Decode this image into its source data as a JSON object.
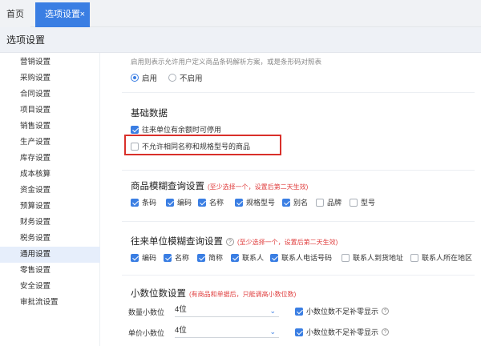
{
  "tabs": {
    "home": "首页",
    "active": "选项设置",
    "close": "×"
  },
  "page_title": "选项设置",
  "sidebar": {
    "items": [
      {
        "label": "营销设置"
      },
      {
        "label": "采购设置"
      },
      {
        "label": "合同设置"
      },
      {
        "label": "项目设置"
      },
      {
        "label": "销售设置"
      },
      {
        "label": "生产设置"
      },
      {
        "label": "库存设置"
      },
      {
        "label": "成本核算"
      },
      {
        "label": "资金设置"
      },
      {
        "label": "预算设置"
      },
      {
        "label": "财务设置"
      },
      {
        "label": "税务设置"
      },
      {
        "label": "通用设置"
      },
      {
        "label": "零售设置"
      },
      {
        "label": "安全设置"
      },
      {
        "label": "审批流设置"
      }
    ],
    "active": "通用设置"
  },
  "barcode": {
    "hint": "启用则表示允许用户定义商品条码解析方案，或是条形码对照表",
    "enable": "启用",
    "disable": "不启用"
  },
  "basic": {
    "title": "基础数据",
    "opt1": "往来单位有余额时可停用",
    "opt2": "不允许相同名称和规格型号的商品"
  },
  "product_fuzzy": {
    "title": "商品模糊查询设置",
    "note": "(至少选择一个，设置后第二天生效)",
    "options": [
      "条码",
      "编码",
      "名称",
      "规格型号",
      "别名",
      "品牌",
      "型号"
    ]
  },
  "partner_fuzzy": {
    "title": "往来单位模糊查询设置",
    "icon": "?",
    "note": "(至少选择一个，设置后第二天生效)",
    "options": [
      "编码",
      "名称",
      "简称",
      "联系人",
      "联系人电话号码",
      "联系人到货地址",
      "联系人所在地区"
    ]
  },
  "decimals": {
    "title": "小数位数设置",
    "note": "(有商品和单据后，只能调高小数位数)",
    "qty_label": "数量小数位",
    "qty_value": "4位",
    "price_label": "单价小数位",
    "price_value": "4位",
    "pad_label": "小数位数不足补零显示",
    "pad_icon": "?"
  },
  "colors": {
    "accent": "#3a7ee3",
    "highlight": "#d9302a"
  },
  "icons": [
    "close-icon",
    "chevron-down-icon",
    "question-icon"
  ]
}
